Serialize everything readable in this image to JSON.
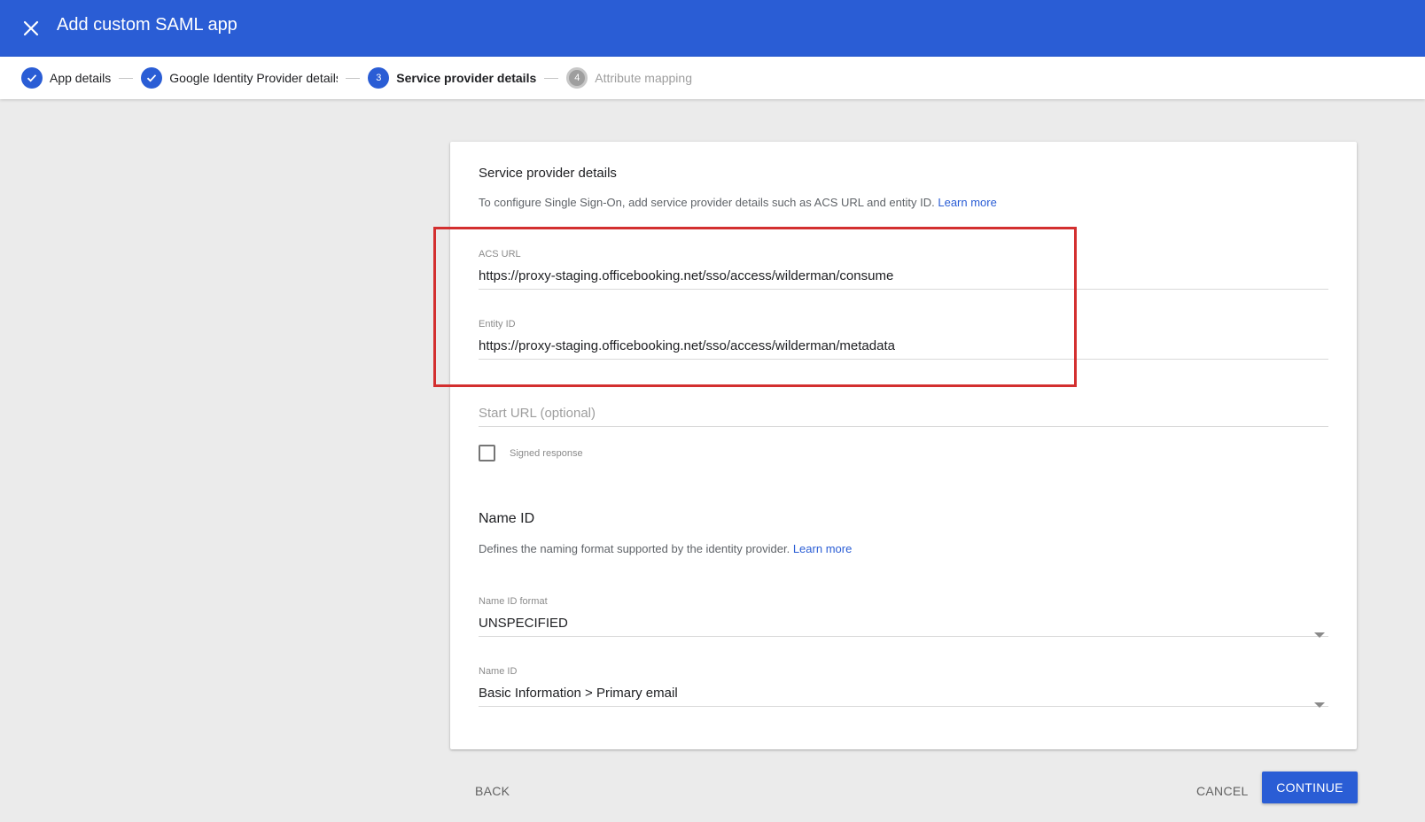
{
  "header": {
    "title": "Add custom SAML app"
  },
  "stepper": {
    "steps": [
      {
        "label": "App details",
        "state": "done"
      },
      {
        "label": "Google Identity Provider details",
        "state": "done"
      },
      {
        "label": "Service provider details",
        "state": "active",
        "number": "3"
      },
      {
        "label": "Attribute mapping",
        "state": "inactive",
        "number": "4"
      }
    ]
  },
  "service_provider": {
    "title": "Service provider details",
    "description": "To configure Single Sign-On, add service provider details such as ACS URL and entity ID.",
    "learn_more": "Learn more",
    "acs_url": {
      "label": "ACS URL",
      "value": "https://proxy-staging.officebooking.net/sso/access/wilderman/consume"
    },
    "entity_id": {
      "label": "Entity ID",
      "value": "https://proxy-staging.officebooking.net/sso/access/wilderman/metadata"
    },
    "start_url": {
      "placeholder": "Start URL (optional)"
    },
    "signed_response": {
      "label": "Signed response",
      "checked": false
    }
  },
  "name_id": {
    "title": "Name ID",
    "description": "Defines the naming format supported by the identity provider.",
    "learn_more": "Learn more",
    "format": {
      "label": "Name ID format",
      "value": "UNSPECIFIED"
    },
    "name_id": {
      "label": "Name ID",
      "value": "Basic Information > Primary email"
    }
  },
  "actions": {
    "back": "BACK",
    "cancel": "CANCEL",
    "continue": "CONTINUE"
  },
  "colors": {
    "primary": "#2a5dd5",
    "highlight": "#d32f2f"
  }
}
